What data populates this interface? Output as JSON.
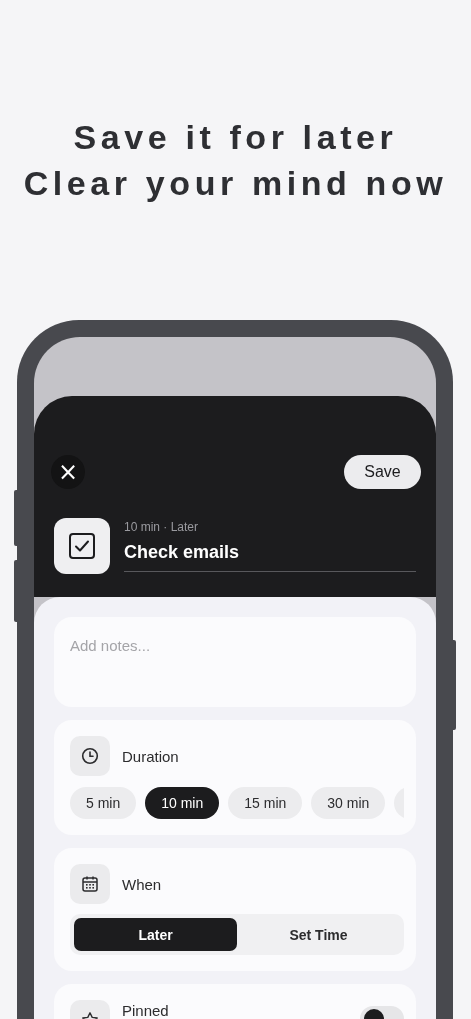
{
  "headline": [
    "Save it for later",
    "Clear your mind now"
  ],
  "header": {
    "close": "×",
    "save": "Save"
  },
  "task": {
    "checked": true,
    "meta": "10 min · Later",
    "title": "Check emails"
  },
  "notes": {
    "placeholder": "Add notes..."
  },
  "duration": {
    "label": "Duration",
    "options": [
      {
        "label": "5 min",
        "selected": false
      },
      {
        "label": "10 min",
        "selected": true
      },
      {
        "label": "15 min",
        "selected": false
      },
      {
        "label": "30 min",
        "selected": false
      }
    ]
  },
  "when": {
    "label": "When",
    "options": [
      {
        "label": "Later",
        "selected": true
      },
      {
        "label": "Set Time",
        "selected": false
      }
    ]
  },
  "pinned": {
    "label": "Pinned",
    "on": false
  }
}
